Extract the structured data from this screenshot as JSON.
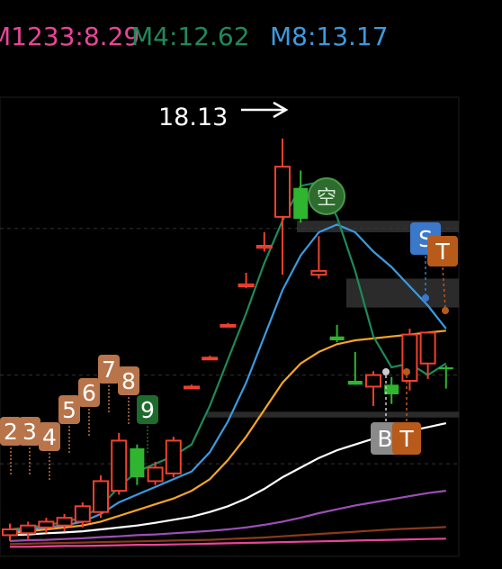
{
  "legend": [
    {
      "label": "M1233:8.29",
      "color": "#e8459a"
    },
    {
      "label": "M4:12.62",
      "color": "#1e8a5a"
    },
    {
      "label": "M8:13.17",
      "color": "#3b9be0"
    }
  ],
  "peak_annotation": {
    "value": "18.13",
    "arrow": "right-arrow-icon"
  },
  "colors": {
    "up": "#f0412f",
    "down": "#2fb52f",
    "background": "#000000",
    "band": "#3a3a3a",
    "ma_green": "#1e8a5a",
    "ma_blue": "#3b9be0",
    "ma_yellow": "#f5a623",
    "ma_white": "#ffffff",
    "ma_purple": "#9b4fb5",
    "ma_brown": "#8b3a1a",
    "ma_pink": "#e8459a",
    "count_badge": "#b8744a",
    "count_badge_green": "#1e6b2e",
    "s_badge": "#3b78c9",
    "t_badge": "#b85a1a",
    "b_badge": "#8a8a8a"
  },
  "chart_data": {
    "type": "candlestick",
    "y_range": [
      7.3,
      19.2
    ],
    "candles": [
      {
        "o": 7.85,
        "h": 8.15,
        "l": 7.7,
        "c": 8.0
      },
      {
        "o": 7.9,
        "h": 8.2,
        "l": 7.75,
        "c": 8.1
      },
      {
        "o": 8.05,
        "h": 8.3,
        "l": 7.9,
        "c": 8.2
      },
      {
        "o": 8.1,
        "h": 8.4,
        "l": 7.95,
        "c": 8.3
      },
      {
        "o": 8.2,
        "h": 8.7,
        "l": 8.05,
        "c": 8.6
      },
      {
        "o": 8.45,
        "h": 9.4,
        "l": 8.3,
        "c": 9.25
      },
      {
        "o": 9.0,
        "h": 10.5,
        "l": 8.9,
        "c": 10.3
      },
      {
        "o": 10.1,
        "h": 10.2,
        "l": 9.15,
        "c": 9.35
      },
      {
        "o": 9.25,
        "h": 9.75,
        "l": 9.15,
        "c": 9.6
      },
      {
        "o": 9.45,
        "h": 10.4,
        "l": 9.35,
        "c": 10.3
      },
      {
        "o": 11.7,
        "h": 11.75,
        "l": 11.65,
        "c": 11.7
      },
      {
        "o": 12.45,
        "h": 12.5,
        "l": 12.4,
        "c": 12.45
      },
      {
        "o": 13.3,
        "h": 13.35,
        "l": 13.25,
        "c": 13.3
      },
      {
        "o": 14.3,
        "h": 14.65,
        "l": 14.25,
        "c": 14.35
      },
      {
        "o": 15.3,
        "h": 15.7,
        "l": 15.2,
        "c": 15.35
      },
      {
        "o": 16.1,
        "h": 18.13,
        "l": 14.6,
        "c": 17.4
      },
      {
        "o": 16.85,
        "h": 17.3,
        "l": 15.95,
        "c": 16.05
      },
      {
        "o": 14.6,
        "h": 15.6,
        "l": 14.5,
        "c": 14.7
      },
      {
        "o": 13.0,
        "h": 13.3,
        "l": 12.85,
        "c": 12.9
      },
      {
        "o": 11.85,
        "h": 12.6,
        "l": 11.75,
        "c": 11.75
      },
      {
        "o": 11.7,
        "h": 12.1,
        "l": 11.2,
        "c": 12.0
      },
      {
        "o": 11.75,
        "h": 11.95,
        "l": 11.25,
        "c": 11.5
      },
      {
        "o": 11.85,
        "h": 13.2,
        "l": 11.6,
        "c": 13.05
      },
      {
        "o": 12.3,
        "h": 13.1,
        "l": 11.9,
        "c": 13.1
      },
      {
        "o": 12.2,
        "h": 12.25,
        "l": 11.65,
        "c": 12.15
      }
    ],
    "series": [
      {
        "name": "M1233",
        "color": "#e8459a",
        "values": [
          7.55,
          7.55,
          7.56,
          7.57,
          7.57,
          7.58,
          7.59,
          7.6,
          7.6,
          7.61,
          7.62,
          7.63,
          7.64,
          7.65,
          7.66,
          7.67,
          7.68,
          7.69,
          7.7,
          7.71,
          7.72,
          7.73,
          7.74,
          7.75,
          7.76
        ]
      },
      {
        "name": "M4",
        "color": "#1e8a5a",
        "values": [
          8.0,
          8.05,
          8.1,
          8.2,
          8.3,
          8.6,
          9.1,
          9.5,
          9.7,
          9.9,
          10.2,
          11.2,
          12.4,
          13.6,
          14.9,
          16.0,
          16.9,
          17.0,
          16.1,
          14.7,
          13.0,
          12.2,
          12.3,
          12.0,
          12.3
        ]
      },
      {
        "name": "M8",
        "color": "#3b9be0",
        "values": [
          7.95,
          8.0,
          8.05,
          8.1,
          8.2,
          8.4,
          8.7,
          8.9,
          9.1,
          9.3,
          9.5,
          10.0,
          10.8,
          11.8,
          13.0,
          14.2,
          15.1,
          15.7,
          15.9,
          15.7,
          15.2,
          14.8,
          14.3,
          13.8,
          13.2
        ]
      },
      {
        "values": [
          7.9,
          7.95,
          8.0,
          8.05,
          8.1,
          8.2,
          8.35,
          8.5,
          8.65,
          8.8,
          9.0,
          9.3,
          9.8,
          10.4,
          11.1,
          11.8,
          12.3,
          12.6,
          12.8,
          12.9,
          12.95,
          13.0,
          13.05,
          13.1,
          13.15
        ]
      },
      {
        "values": [
          7.85,
          7.87,
          7.9,
          7.92,
          7.95,
          8.0,
          8.05,
          8.1,
          8.17,
          8.25,
          8.33,
          8.45,
          8.6,
          8.8,
          9.05,
          9.35,
          9.6,
          9.85,
          10.05,
          10.2,
          10.35,
          10.45,
          10.55,
          10.65,
          10.75
        ]
      },
      {
        "values": [
          7.7,
          7.72,
          7.73,
          7.75,
          7.77,
          7.8,
          7.82,
          7.85,
          7.87,
          7.9,
          7.93,
          7.96,
          8.0,
          8.05,
          8.12,
          8.2,
          8.3,
          8.42,
          8.52,
          8.62,
          8.7,
          8.78,
          8.86,
          8.94,
          9.0
        ]
      },
      {
        "values": [
          7.62,
          7.63,
          7.64,
          7.65,
          7.66,
          7.67,
          7.68,
          7.69,
          7.7,
          7.71,
          7.72,
          7.73,
          7.75,
          7.77,
          7.79,
          7.82,
          7.85,
          7.88,
          7.91,
          7.94,
          7.97,
          8.0,
          8.02,
          8.04,
          8.06
        ]
      }
    ],
    "markers": [
      {
        "label": "2",
        "index": 0,
        "type": "count"
      },
      {
        "label": "3",
        "index": 1,
        "type": "count"
      },
      {
        "label": "4",
        "index": 2,
        "type": "count"
      },
      {
        "label": "5",
        "index": 3,
        "type": "count"
      },
      {
        "label": "6",
        "index": 4,
        "type": "count"
      },
      {
        "label": "7",
        "index": 5,
        "type": "count"
      },
      {
        "label": "8",
        "index": 6,
        "type": "count"
      },
      {
        "label": "9",
        "index": 7,
        "type": "count-green"
      },
      {
        "label": "S",
        "index": 23,
        "type": "sell"
      },
      {
        "label": "T",
        "index": 24,
        "type": "t-top"
      },
      {
        "label": "B",
        "index": 20,
        "type": "buy"
      },
      {
        "label": "T",
        "index": 21,
        "type": "t-bottom"
      },
      {
        "label": "空",
        "index": 16,
        "type": "empty-circle"
      }
    ]
  }
}
